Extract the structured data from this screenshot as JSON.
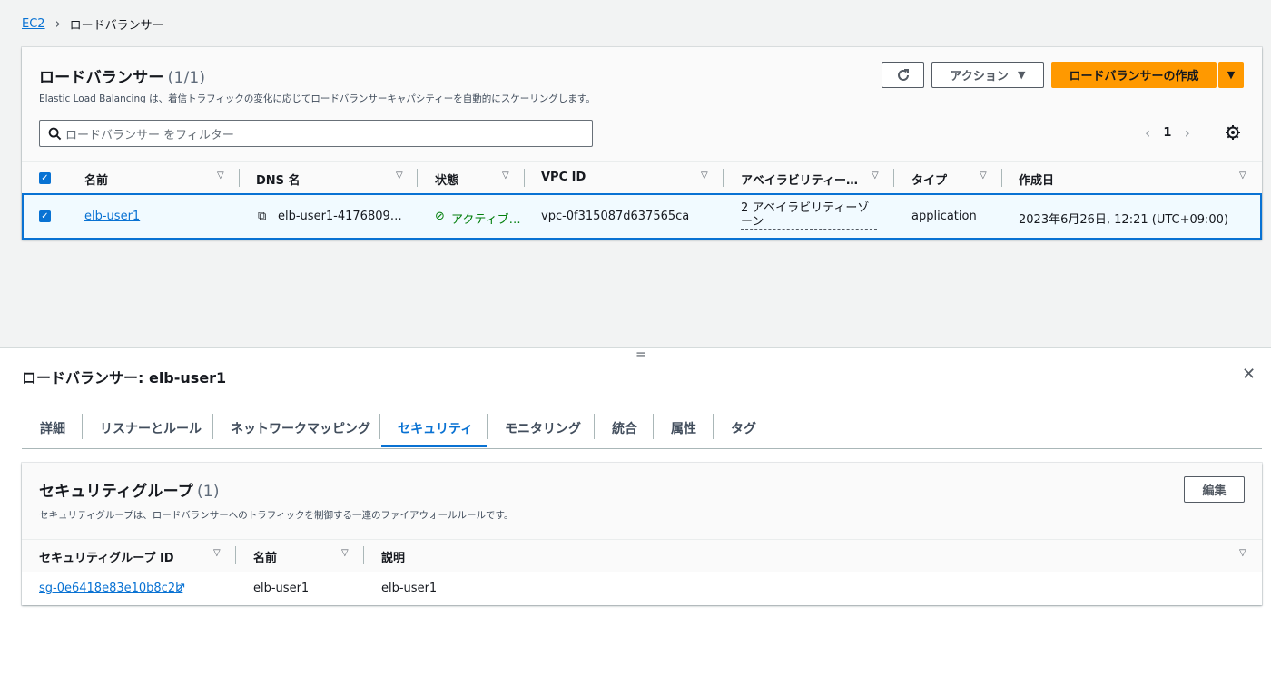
{
  "breadcrumb": {
    "root": "EC2",
    "current": "ロードバランサー"
  },
  "lb_panel": {
    "title": "ロードバランサー",
    "count": "(1/1)",
    "description": "Elastic Load Balancing は、着信トラフィックの変化に応じてロードバランサーキャパシティーを自動的にスケーリングします。",
    "actions_label": "アクション",
    "create_label": "ロードバランサーの作成",
    "filter_placeholder": "ロードバランサー をフィルター",
    "page": "1",
    "columns": [
      "名前",
      "DNS 名",
      "状態",
      "VPC ID",
      "アベイラビリティー…",
      "タイプ",
      "作成日"
    ],
    "row": {
      "name": "elb-user1",
      "dns": "elb-user1-4176809…",
      "state": "アクティブ…",
      "vpc_id": "vpc-0f315087d637565ca",
      "az_line1": "2 アベイラビリティーゾ",
      "az_line2": "ーン",
      "type": "application",
      "created": "2023年6月26日, 12:21 (UTC+09:00)"
    }
  },
  "detail": {
    "title": "ロードバランサー: elb-user1",
    "tabs": [
      "詳細",
      "リスナーとルール",
      "ネットワークマッピング",
      "セキュリティ",
      "モニタリング",
      "統合",
      "属性",
      "タグ"
    ],
    "active_tab": "セキュリティ"
  },
  "security_groups": {
    "title": "セキュリティグループ",
    "count": "(1)",
    "description": "セキュリティグループは、ロードバランサーへのトラフィックを制御する一連のファイアウォールルールです。",
    "edit_label": "編集",
    "columns": [
      "セキュリティグループ ID",
      "名前",
      "説明"
    ],
    "row": {
      "id": "sg-0e6418e83e10b8c2b",
      "name": "elb-user1",
      "description": "elb-user1"
    }
  },
  "colors": {
    "accent": "#0972d3",
    "primary_button": "#ff9900",
    "success": "#037f0c"
  },
  "icons": [
    "refresh-icon",
    "caret-down-icon",
    "search-icon",
    "chevron-left-icon",
    "chevron-right-icon",
    "gear-icon",
    "checkbox-icon",
    "copy-icon",
    "status-check-icon",
    "close-icon",
    "external-link-icon",
    "sort-icon",
    "resize-handle-icon"
  ]
}
